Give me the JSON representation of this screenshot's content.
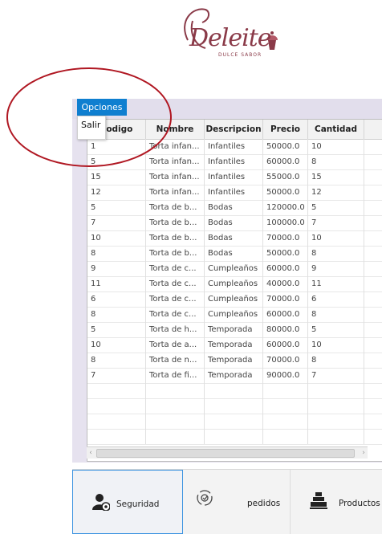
{
  "logo": {
    "name": "Deleite",
    "subtitle": "DULCE SABOR"
  },
  "menu": {
    "label": "Opciones",
    "items": [
      "Salir"
    ]
  },
  "table": {
    "columns": [
      "Codigo",
      "Nombre",
      "Descripcion",
      "Precio",
      "Cantidad"
    ],
    "rows": [
      [
        "1",
        "Torta infan...",
        "Infantiles",
        "50000.0",
        "10"
      ],
      [
        "5",
        "Torta infan...",
        "Infantiles",
        "60000.0",
        "8"
      ],
      [
        "15",
        "Torta infan...",
        "Infantiles",
        "55000.0",
        "15"
      ],
      [
        "12",
        "Torta infan...",
        "Infantiles",
        "50000.0",
        "12"
      ],
      [
        "5",
        "Torta de b...",
        "Bodas",
        "120000.0",
        "5"
      ],
      [
        "7",
        "Torta de b...",
        "Bodas",
        "100000.0",
        "7"
      ],
      [
        "10",
        "Torta de b...",
        "Bodas",
        "70000.0",
        "10"
      ],
      [
        "8",
        "Torta de b...",
        "Bodas",
        "50000.0",
        "8"
      ],
      [
        "9",
        "Torta de c...",
        "Cumpleaños",
        "60000.0",
        "9"
      ],
      [
        "11",
        "Torta de c...",
        "Cumpleaños",
        "40000.0",
        "11"
      ],
      [
        "6",
        "Torta de c...",
        "Cumpleaños",
        "70000.0",
        "6"
      ],
      [
        "8",
        "Torta de c...",
        "Cumpleaños",
        "60000.0",
        "8"
      ],
      [
        "5",
        "Torta de h...",
        "Temporada",
        "80000.0",
        "5"
      ],
      [
        "10",
        "Torta de a...",
        "Temporada",
        "60000.0",
        "10"
      ],
      [
        "8",
        "Torta de n...",
        "Temporada",
        "70000.0",
        "8"
      ],
      [
        "7",
        "Torta de fi...",
        "Temporada",
        "90000.0",
        "7"
      ]
    ]
  },
  "nav": {
    "seguridad": "Seguridad",
    "pedidos": "pedidos",
    "productos": "Productos"
  },
  "colors": {
    "accent": "#0f7fd0",
    "brand": "#8a3a48",
    "annotation": "#b01722"
  }
}
